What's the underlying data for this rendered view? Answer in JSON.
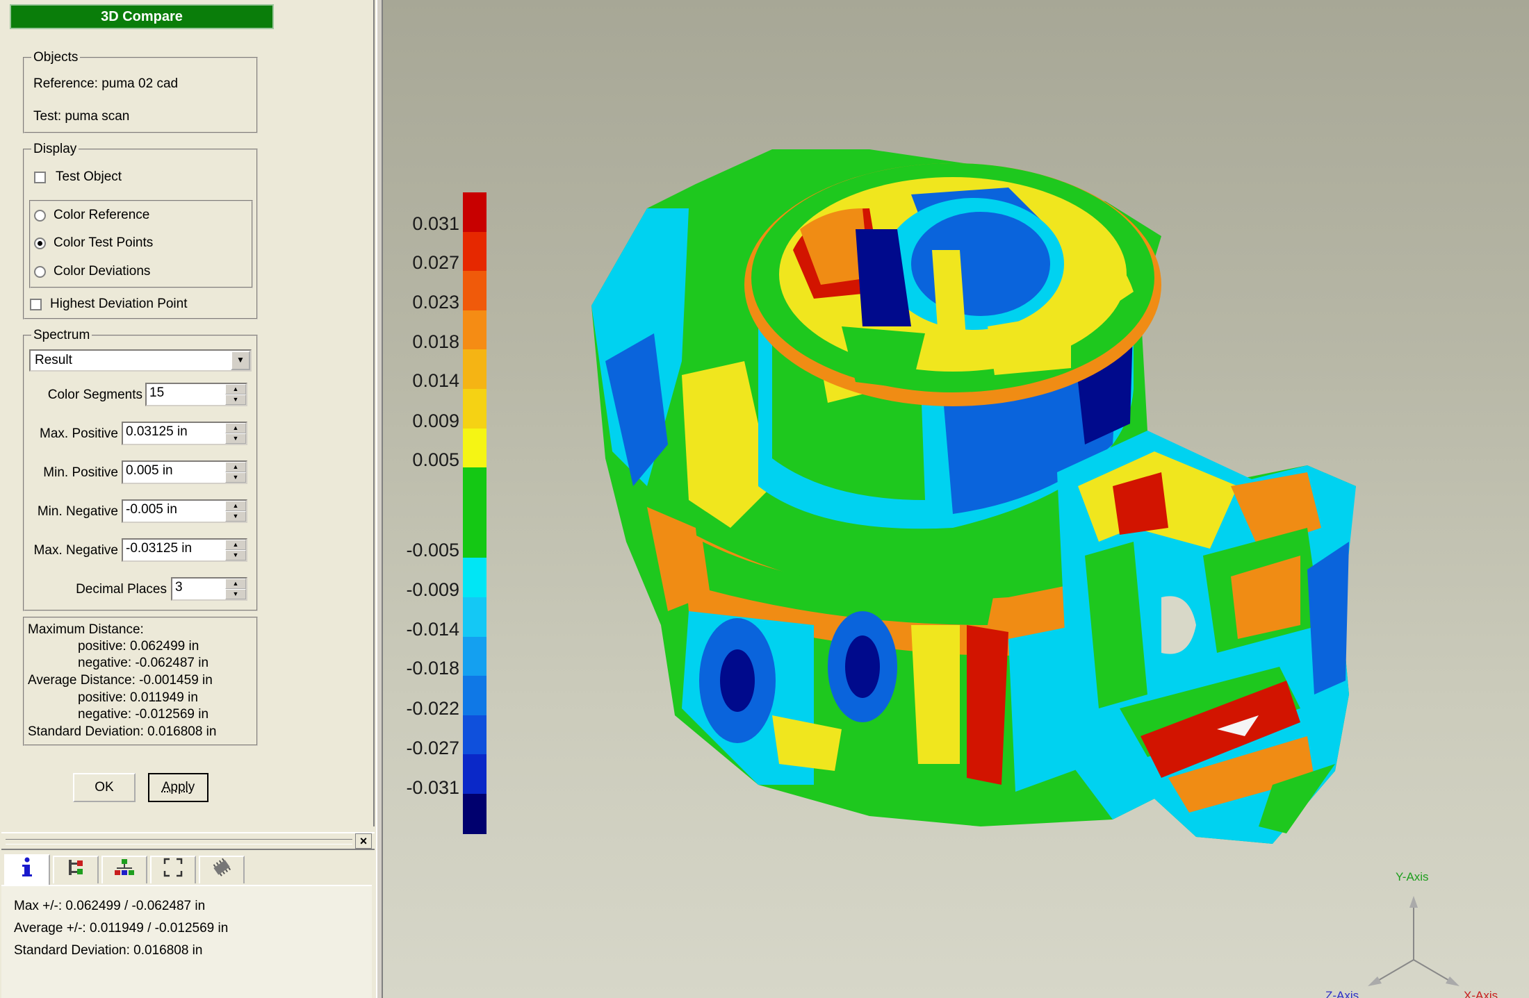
{
  "dialog": {
    "title": "3D Compare",
    "objects": {
      "legend": "Objects",
      "reference": "Reference: puma 02 cad",
      "test": "Test: puma scan"
    },
    "display": {
      "legend": "Display",
      "test_object": "Test Object",
      "test_object_checked": false,
      "radio_options": [
        {
          "label": "Color Reference",
          "selected": false
        },
        {
          "label": "Color Test Points",
          "selected": true
        },
        {
          "label": "Color Deviations",
          "selected": false
        }
      ],
      "highest_deviation": "Highest Deviation Point",
      "highest_deviation_checked": false
    },
    "spectrum": {
      "legend": "Spectrum",
      "selected": "Result",
      "fields": [
        {
          "label": "Color Segments",
          "value": "15"
        },
        {
          "label": "Max. Positive",
          "value": "0.03125 in"
        },
        {
          "label": "Min. Positive",
          "value": "0.005 in"
        },
        {
          "label": "Min. Negative",
          "value": "-0.005 in"
        },
        {
          "label": "Max. Negative",
          "value": "-0.03125 in"
        },
        {
          "label": "Decimal Places",
          "value": "3"
        }
      ]
    },
    "stats": [
      "Maximum Distance:",
      "positive: 0.062499 in",
      "negative: -0.062487 in",
      "Average Distance: -0.001459 in",
      "positive: 0.011949 in",
      "negative: -0.012569 in",
      "Standard Deviation: 0.016808 in"
    ],
    "buttons": {
      "ok": "OK",
      "apply": "Apply"
    }
  },
  "info_panel": {
    "tabs": [
      "info-icon",
      "tree-icon",
      "hierarchy-icon",
      "fullscreen-icon",
      "chip-icon"
    ],
    "close": "×",
    "lines": [
      "Max +/-: 0.062499 / -0.062487 in",
      "Average +/-: 0.011949 / -0.012569 in",
      "Standard Deviation: 0.016808 in"
    ]
  },
  "viewport": {
    "legend_labels": [
      "0.031",
      "0.027",
      "0.023",
      "0.018",
      "0.014",
      "0.009",
      "0.005",
      "-0.005",
      "-0.009",
      "-0.014",
      "-0.018",
      "-0.022",
      "-0.027",
      "-0.031"
    ],
    "legend_colors": [
      "#c80000",
      "#e62800",
      "#f05a0a",
      "#f58c14",
      "#f5b414",
      "#f5d214",
      "#f5f514",
      "#14c814",
      "#00e6f5",
      "#14c8f5",
      "#14a0f0",
      "#0f78e6",
      "#0f50dc",
      "#0a28c8",
      "#00006e"
    ],
    "axes": {
      "y": "Y-Axis",
      "z": "Z-Axis",
      "x": "X-Axis"
    },
    "colors": {
      "green": "#1ec81e",
      "cyan": "#00d2f0",
      "blue": "#0a64dc",
      "navy": "#000a8c",
      "yellow": "#f0e61e",
      "orange": "#f08c14",
      "red": "#d21400"
    }
  }
}
